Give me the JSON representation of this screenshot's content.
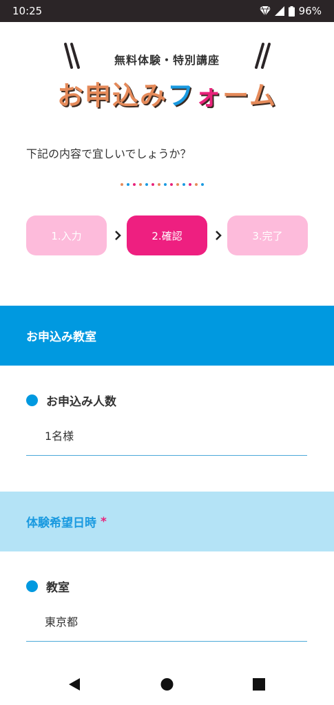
{
  "status_bar": {
    "time": "10:25",
    "battery": "96%"
  },
  "header": {
    "subtitle": "無料体験・特別講座",
    "title_parts": [
      "お申込み",
      "フ",
      "ォ",
      "ーム"
    ]
  },
  "prompt": "下記の内容で宜しいでしょうか？",
  "steps": [
    {
      "label": "1.入力",
      "state": "inactive"
    },
    {
      "label": "2.確認",
      "state": "active"
    },
    {
      "label": "3.完了",
      "state": "inactive"
    }
  ],
  "colors": {
    "step_active": "#ee1f80",
    "step_inactive": "#fdbbdb",
    "primary_blue": "#0099e0",
    "light_blue": "#b4e3f6",
    "pink": "#e8227a"
  },
  "sections": {
    "classroom": {
      "title": "お申込み教室",
      "field_label": "お申込み人数",
      "field_value": "1名様"
    },
    "schedule": {
      "title": "体験希望日時",
      "required_mark": "*",
      "field_label": "教室",
      "field_value": "東京都"
    }
  },
  "nav": {
    "back": "back-icon",
    "home": "home-icon",
    "recents": "recents-icon"
  }
}
